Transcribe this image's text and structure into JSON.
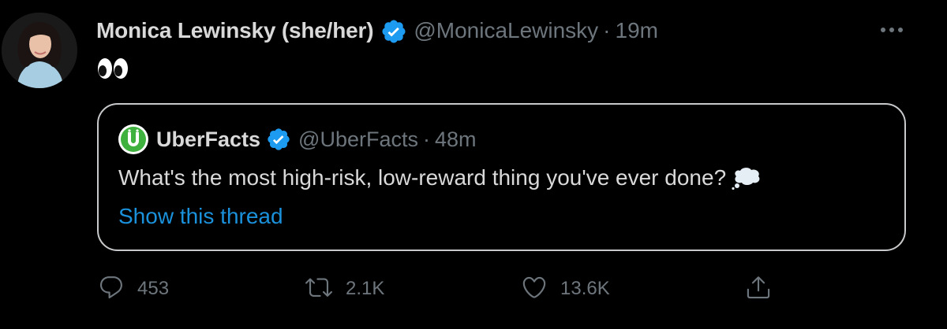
{
  "tweet": {
    "author": {
      "display_name": "Monica Lewinsky (she/her)",
      "handle": "@MonicaLewinsky",
      "time": "19m",
      "verified": true
    },
    "body_emoji": "eyes-emoji",
    "quoted": {
      "display_name": "UberFacts",
      "handle": "@UberFacts",
      "time": "48m",
      "verified": true,
      "text": "What's the most high-risk, low-reward thing you've ever done?",
      "text_emoji": "thought-balloon-emoji",
      "show_thread": "Show this thread"
    },
    "actions": {
      "replies": "453",
      "retweets": "2.1K",
      "likes": "13.6K"
    },
    "separator": "·"
  },
  "colors": {
    "background": "#000000",
    "text": "#d9d9d9",
    "secondary": "#6e767d",
    "link": "#1a91da",
    "verified": "#1d9bf0",
    "uberfacts_green": "#3fb13f"
  },
  "icons": [
    "more-icon",
    "verified-icon",
    "reply-icon",
    "retweet-icon",
    "like-icon",
    "share-icon"
  ]
}
